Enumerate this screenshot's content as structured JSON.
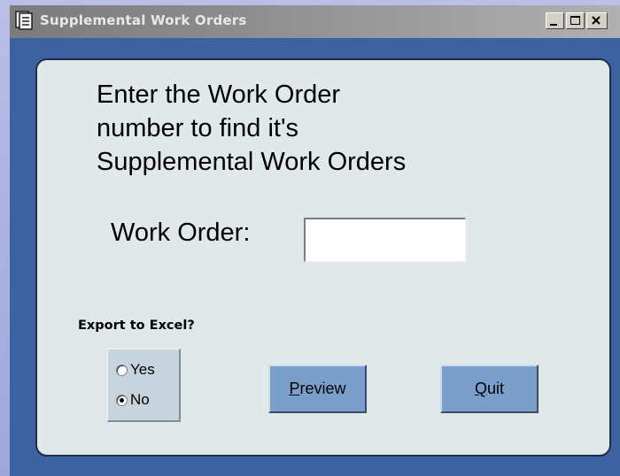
{
  "window": {
    "title": "Supplemental Work Orders",
    "icon": "form-icon"
  },
  "titlebar_buttons": {
    "minimize": "minimize-icon",
    "maximize": "maximize-icon",
    "close": "close-icon"
  },
  "form": {
    "instruction": "Enter the Work Order\nnumber to find it's\nSupplemental Work Orders",
    "work_order_label": "Work Order:",
    "work_order_value": "",
    "export_label": "Export to Excel?",
    "export_options": [
      {
        "label": "Yes",
        "selected": false
      },
      {
        "label": "No",
        "selected": true
      }
    ],
    "preview_button": {
      "accel": "P",
      "rest": "review"
    },
    "quit_button": {
      "accel": "Q",
      "rest": "uit"
    }
  },
  "colors": {
    "window_frame": "#3c62a0",
    "panel_background": "#e1e8ea",
    "button_background": "#7a9fca",
    "desktop": "#aab2e0"
  }
}
